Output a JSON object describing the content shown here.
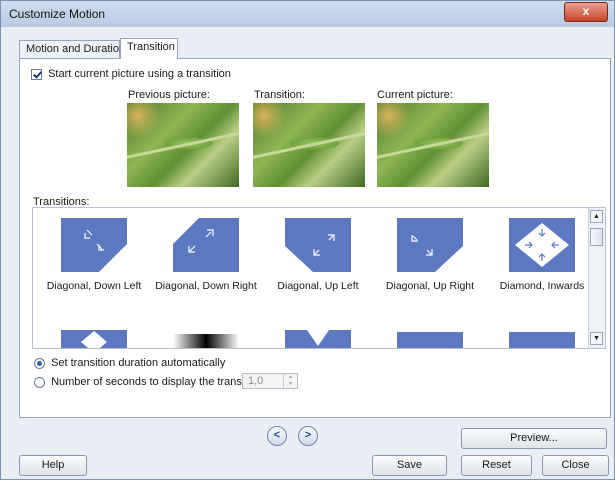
{
  "window": {
    "title": "Customize Motion",
    "close_glyph": "x"
  },
  "tabs": [
    {
      "label": "Motion and Duration"
    },
    {
      "label": "Transition"
    }
  ],
  "transition_panel": {
    "start_checkbox_label": "Start current picture using a transition",
    "previous_label": "Previous picture:",
    "transition_label": "Transition:",
    "current_label": "Current picture:",
    "transitions_label": "Transitions:",
    "items": [
      {
        "caption": "Diagonal, Down Left",
        "icon": "diagonal-down-left-icon"
      },
      {
        "caption": "Diagonal, Down Right",
        "icon": "diagonal-down-right-icon"
      },
      {
        "caption": "Diagonal, Up Left",
        "icon": "diagonal-up-left-icon"
      },
      {
        "caption": "Diagonal, Up Right",
        "icon": "diagonal-up-right-icon"
      },
      {
        "caption": "Diamond, Inwards",
        "icon": "diamond-inwards-icon"
      }
    ],
    "radio_auto_label": "Set transition duration automatically",
    "radio_seconds_label": "Number of seconds to display the transition",
    "seconds_value": "1,0"
  },
  "buttons": {
    "prev": "<",
    "next": ">",
    "preview": "Preview...",
    "help": "Help",
    "save": "Save",
    "reset": "Reset",
    "close": "Close"
  },
  "colors": {
    "transition_blue": "#5b78c0",
    "title_bar": "#c4d4ea"
  }
}
